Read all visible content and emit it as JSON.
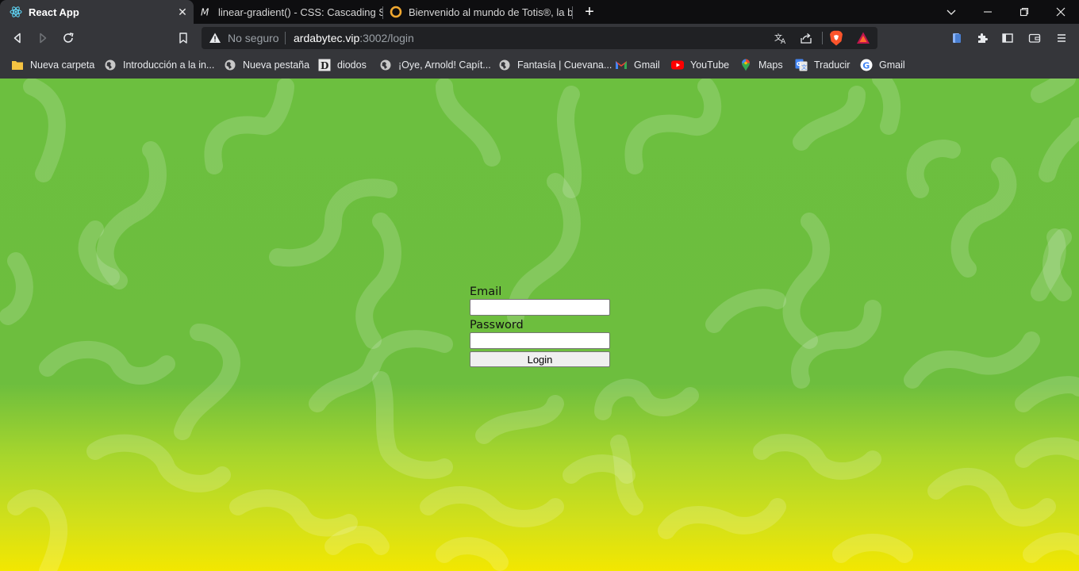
{
  "tabs": [
    {
      "title": "React App",
      "active": true,
      "favicon": "react-icon"
    },
    {
      "title": "linear-gradient() - CSS: Cascading Style",
      "active": false,
      "favicon": "mdn-icon"
    },
    {
      "title": "Bienvenido al mundo de Totis®, la bot",
      "active": false,
      "favicon": "totis-icon"
    }
  ],
  "omnibox": {
    "security_text": "No seguro",
    "url_host": "ardabytec.vip",
    "url_rest": ":3002/login"
  },
  "bookmarks": [
    {
      "label": "Nueva carpeta",
      "icon": "folder-icon"
    },
    {
      "label": "Introducción a la in...",
      "icon": "globe-icon"
    },
    {
      "label": "Nueva pestaña",
      "icon": "globe-icon"
    },
    {
      "label": "diodos",
      "icon": "diodos-icon"
    },
    {
      "label": "¡Oye, Arnold! Capít...",
      "icon": "globe-icon"
    },
    {
      "label": "Fantasía | Cuevana...",
      "icon": "globe-icon"
    },
    {
      "label": "Gmail",
      "icon": "gmail-icon"
    },
    {
      "label": "YouTube",
      "icon": "youtube-icon"
    },
    {
      "label": "Maps",
      "icon": "maps-icon"
    },
    {
      "label": "Traducir",
      "icon": "translate-icon"
    },
    {
      "label": "Gmail",
      "icon": "google-icon"
    }
  ],
  "login": {
    "email_label": "Email",
    "email_value": "",
    "password_label": "Password",
    "password_value": "",
    "button_label": "Login"
  },
  "colors": {
    "page_gradient_top": "#6cbf3f",
    "page_gradient_bottom": "#f3e700",
    "tab_active_bg": "#35363a",
    "tabstrip_bg": "#0e0e10"
  }
}
